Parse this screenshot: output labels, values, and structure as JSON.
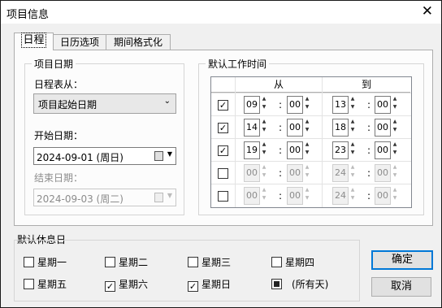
{
  "window": {
    "title": "项目信息",
    "close_symbol": "✕"
  },
  "tabs": [
    "日程",
    "日历选项",
    "期间格式化"
  ],
  "schedule": {
    "project_dates_group": "项目日期",
    "schedule_from_label": "日程表从：",
    "schedule_from_value": "项目起始日期",
    "start_date_label": "开始日期：",
    "start_date_value": "2024-09-01 (周日)",
    "end_date_label": "结束日期：",
    "end_date_value": "2024-09-03 (周二)"
  },
  "work_time": {
    "group_title": "默认工作时间",
    "from_header": "从",
    "to_header": "到",
    "separator": ":",
    "rows": [
      {
        "checked": true,
        "enabled": true,
        "from_h": "09",
        "from_m": "00",
        "to_h": "13",
        "to_m": "00"
      },
      {
        "checked": true,
        "enabled": true,
        "from_h": "14",
        "from_m": "00",
        "to_h": "18",
        "to_m": "00"
      },
      {
        "checked": true,
        "enabled": true,
        "from_h": "19",
        "from_m": "00",
        "to_h": "23",
        "to_m": "00"
      },
      {
        "checked": false,
        "enabled": false,
        "from_h": "00",
        "from_m": "00",
        "to_h": "24",
        "to_m": "00"
      },
      {
        "checked": false,
        "enabled": false,
        "from_h": "00",
        "from_m": "00",
        "to_h": "24",
        "to_m": "00"
      }
    ]
  },
  "rest_days": {
    "group_title": "默认休息日",
    "days": [
      {
        "label": "星期一",
        "checked": false
      },
      {
        "label": "星期二",
        "checked": false
      },
      {
        "label": "星期三",
        "checked": false
      },
      {
        "label": "星期四",
        "checked": false
      },
      {
        "label": "星期五",
        "checked": false
      },
      {
        "label": "星期六",
        "checked": true
      },
      {
        "label": "星期日",
        "checked": true
      },
      {
        "label": "(所有天)",
        "checked": "indeterminate"
      }
    ]
  },
  "buttons": {
    "ok": "确定",
    "cancel": "取消"
  },
  "colors": {
    "accent": "#0078d7",
    "dialog_bg": "#f0f0f0",
    "panel_bg": "#fcfcfc"
  }
}
